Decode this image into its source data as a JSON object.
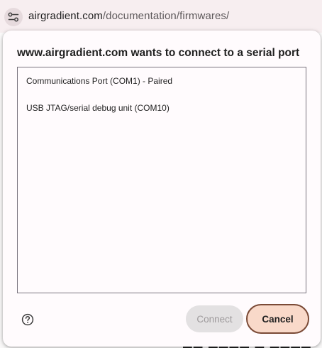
{
  "browser": {
    "url_domain": "airgradient.com",
    "url_path": "/documentation/firmwares/",
    "site_info_icon": "tune-icon"
  },
  "dialog": {
    "title": "www.airgradient.com wants to connect to a serial port",
    "ports": [
      {
        "label": "Communications Port (COM1) - Paired"
      },
      {
        "label": "USB JTAG/serial debug unit (COM10)"
      }
    ],
    "help_icon": "help-circle-icon",
    "connect_label": "Connect",
    "cancel_label": "Cancel",
    "connect_enabled": false
  },
  "colors": {
    "address_bar_bg": "#f7eef0",
    "dialog_bg": "#fffbfd",
    "cancel_bg": "#f9d9c9",
    "cancel_border": "#7a4a36",
    "connect_disabled_bg": "#e3e1e2"
  }
}
